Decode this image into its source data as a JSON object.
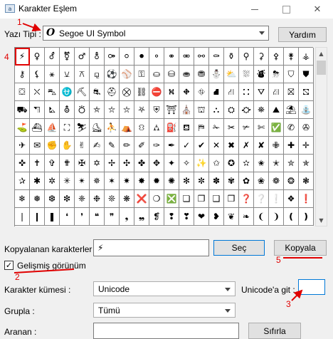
{
  "window": {
    "title": "Karakter Eşlem",
    "icon": "character-map-icon",
    "controls": {
      "minimize": "minimize-icon",
      "maximize": "maximize-icon",
      "close_glyph": "✕"
    }
  },
  "font_row": {
    "label": "Yazı Tipi :",
    "font_icon": "O",
    "selected_font": "Segoe UI Symbol",
    "help_label": "Yardım"
  },
  "grid": {
    "rows": [
      [
        "⚡",
        "♀",
        "⚦",
        "⚧",
        "♂",
        "⚨",
        "⚩",
        "⚪",
        "⚫",
        "⚬",
        "⚭",
        "⚮",
        "⚯",
        "⚰",
        "⚱",
        "⚲",
        "⚳",
        "⚴",
        "⚵",
        "⚶"
      ],
      [
        "⚷",
        "⚸",
        "⚹",
        "⚺",
        "⚻",
        "⚼",
        "⚽",
        "⚾",
        "⚿",
        "⛀",
        "⛁",
        "⛂",
        "⛃",
        "⛄",
        "⛅",
        "⛆",
        "⛇",
        "⛈",
        "⛉",
        "⛊"
      ],
      [
        "⛋",
        "⛌",
        "⛍",
        "⛎",
        "⛏",
        "⛐",
        "⛑",
        "⛒",
        "⛓",
        "⛔",
        "⛕",
        "⛖",
        "⛗",
        "⛘",
        "⛙",
        "⛚",
        "⛛",
        "⛜",
        "⛝",
        "⛞"
      ],
      [
        "⛟",
        "⛠",
        "⛡",
        "⛢",
        "⛣",
        "⛤",
        "⛥",
        "⛦",
        "⛧",
        "⛨",
        "⛩",
        "⛪",
        "⛫",
        "⛬",
        "⛭",
        "⛮",
        "⛯",
        "⛰",
        "⛱",
        "⛲"
      ],
      [
        "⛳",
        "⛴",
        "⛵",
        "⛶",
        "⛷",
        "⛸",
        "⛹",
        "⛺",
        "⛻",
        "⛼",
        "⛽",
        "⛾",
        "⛿",
        "✁",
        "✂",
        "✃",
        "✄",
        "✅",
        "✆",
        "✇"
      ],
      [
        "✈",
        "✉",
        "✊",
        "✋",
        "✌",
        "✍",
        "✎",
        "✏",
        "✐",
        "✑",
        "✒",
        "✓",
        "✔",
        "✕",
        "✖",
        "✗",
        "✘",
        "✙",
        "✚",
        "✛"
      ],
      [
        "✜",
        "✝",
        "✞",
        "✟",
        "✠",
        "✡",
        "✢",
        "✣",
        "✤",
        "✥",
        "✦",
        "✧",
        "✨",
        "✩",
        "✪",
        "✫",
        "✬",
        "✭",
        "✮",
        "✯"
      ],
      [
        "✰",
        "✱",
        "✲",
        "✳",
        "✴",
        "✵",
        "✶",
        "✷",
        "✸",
        "✹",
        "✺",
        "✻",
        "✼",
        "✽",
        "✾",
        "✿",
        "❀",
        "❁",
        "❂",
        "❃"
      ],
      [
        "❄",
        "❅",
        "❆",
        "❇",
        "❈",
        "❉",
        "❊",
        "❋",
        "❌",
        "❍",
        "❎",
        "❏",
        "❐",
        "❑",
        "❒",
        "❓",
        "❔",
        "❕",
        "❖",
        "❗"
      ],
      [
        "❘",
        "❙",
        "❚",
        "❛",
        "❜",
        "❝",
        "❞",
        "❟",
        "❠",
        "❡",
        "❢",
        "❣",
        "❤",
        "❥",
        "❦",
        "❧",
        "❨",
        "❩",
        "❪",
        "❫"
      ]
    ],
    "selected_index": [
      0,
      0
    ],
    "scroll_up_glyph": "▲",
    "scroll_down_glyph": "▼"
  },
  "copy_row": {
    "label": "Kopyalanan karakterler :",
    "value": "⚡",
    "select_label": "Seç",
    "copy_label": "Kopyala"
  },
  "advanced_view": {
    "label": "Gelişmiş görünüm",
    "checked": true,
    "check_glyph": "✓"
  },
  "charset": {
    "label": "Karakter kümesi :",
    "value": "Unicode"
  },
  "goto_unicode": {
    "label": "Unicode'a git :",
    "value": ""
  },
  "group_by": {
    "label": "Grupla :",
    "value": "Tümü"
  },
  "search": {
    "label": "Aranan :",
    "value": "",
    "button_label": "Sıfırla"
  },
  "annotations": {
    "n1": "1",
    "n2": "2",
    "n3": "3",
    "n4": "4",
    "n5": "5",
    "color": "#e00000"
  },
  "colors": {
    "accent": "#0078d7",
    "annotation": "#e00000"
  }
}
